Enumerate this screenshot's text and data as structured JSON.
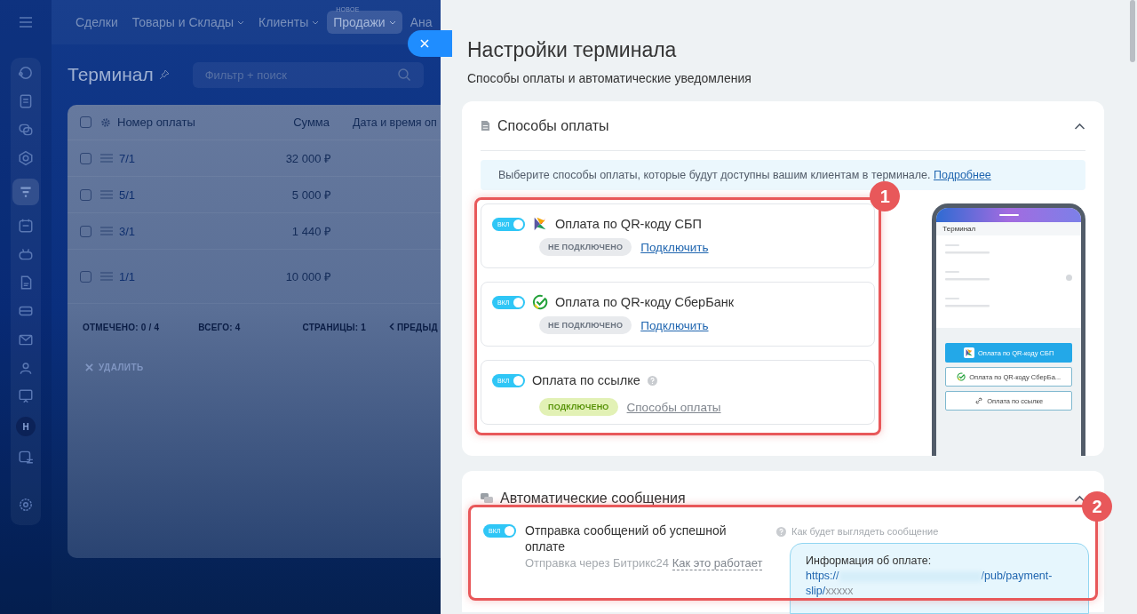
{
  "app": {
    "nav": [
      {
        "label": "Сделки",
        "dropdown": false,
        "selected": false
      },
      {
        "label": "Товары и Склады",
        "dropdown": true,
        "selected": false
      },
      {
        "label": "Клиенты",
        "dropdown": true,
        "selected": false
      },
      {
        "label": "Продажи",
        "dropdown": true,
        "selected": true,
        "badge": "НОВОЕ"
      },
      {
        "label": "Ана",
        "dropdown": false,
        "selected": false
      }
    ],
    "avatar": "Н",
    "page_title": "Терминал",
    "filter": {
      "placeholder": "Фильтр + поиск"
    },
    "table": {
      "all_checked": false,
      "columns": [
        "Номер оплаты",
        "Сумма",
        "Дата и время оп"
      ],
      "rows": [
        {
          "number": "7/1",
          "sum": "32 000 ₽",
          "checked": false
        },
        {
          "number": "5/1",
          "sum": "5 000 ₽",
          "checked": false
        },
        {
          "number": "3/1",
          "sum": "1 440 ₽",
          "checked": false
        },
        {
          "number": "1/1",
          "sum": "10 000 ₽",
          "checked": false
        }
      ],
      "footer": [
        "ОТМЕЧЕНО: **0 / 4**",
        "ВСЕГО: **4**",
        "СТРАНИЦЫ: **1**"
      ],
      "prev": "ПРЕДЫД",
      "delete": "УДАЛИТЬ"
    }
  },
  "panel": {
    "title": "Настройки терминала",
    "subtitle": "Способы оплаты и автоматические уведомления",
    "payment_section": {
      "title": "Способы оплаты",
      "expanded": true,
      "info": "Выберите способы оплаты, которые будут доступны вашим клиентам в терминале.",
      "info_link": "Подробнее",
      "marker": "1",
      "methods": [
        {
          "title": "Оплата по QR-коду СБП",
          "kind": "sbp",
          "on": true,
          "toggle_label": "ВКЛ",
          "help": false,
          "connected": false,
          "status": "НЕ ПОДКЛЮЧЕНО",
          "action": "Подключить"
        },
        {
          "title": "Оплата по QR-коду СберБанк",
          "kind": "sber",
          "on": true,
          "toggle_label": "ВКЛ",
          "help": false,
          "connected": false,
          "status": "НЕ ПОДКЛЮЧЕНО",
          "action": "Подключить"
        },
        {
          "title": "Оплата по ссылке",
          "kind": "link",
          "on": true,
          "toggle_label": "ВКЛ",
          "help": true,
          "connected": true,
          "status": "ПОДКЛЮЧЕНО",
          "action": "Способы оплаты"
        }
      ],
      "preview": {
        "title": "Терминал",
        "buttons": [
          {
            "label": "Оплата по QR-коду СБП",
            "kind": "sbp",
            "selected": true
          },
          {
            "label": "Оплата по QR-коду СберБа...",
            "kind": "sber",
            "selected": false
          },
          {
            "label": "Оплата по ссылке",
            "kind": "link",
            "selected": false
          }
        ]
      }
    },
    "messages_section": {
      "title": "Автоматические сообщения",
      "expanded": true,
      "marker": "2",
      "item": {
        "title": "Отправка сообщений об успешной оплате",
        "on": true,
        "toggle_label": "ВКЛ",
        "via": "Отправка через Битрикс24",
        "link": "Как это работает",
        "preview_hint": "Как будет выглядеть сообщение",
        "message_title": "Информация об оплате:",
        "url_start": "https://",
        "url_path": "/pub/payment-slip/",
        "url_end": "xxxxx"
      }
    }
  }
}
